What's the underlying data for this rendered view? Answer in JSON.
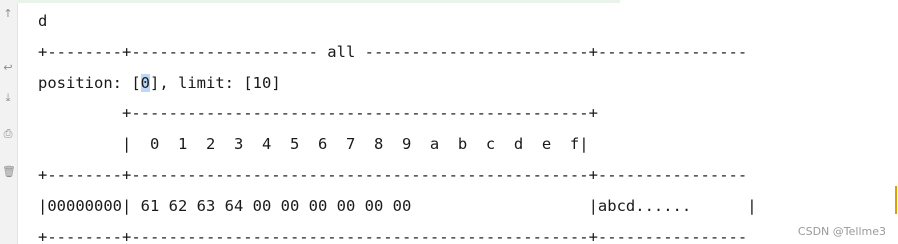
{
  "console": {
    "lines": [
      "d",
      "+--------+-------------------- all ------------------------+----------------",
      {
        "before": "position: [",
        "highlight": "0",
        "after": "], limit: [10]"
      },
      "         +-------------------------------------------------+",
      "         |  0  1  2  3  4  5  6  7  8  9  a  b  c  d  e  f|",
      "+--------+-------------------------------------------------+----------------",
      "|00000000| 61 62 63 64 00 00 00 00 00 00                   |abcd......      |",
      "+--------+-------------------------------------------------+----------------"
    ]
  },
  "gutter": {
    "icons": [
      "up-arrow-icon",
      "wrap-icon",
      "download-icon",
      "print-icon",
      "trash-icon"
    ]
  },
  "watermark": "CSDN @Tellme3"
}
